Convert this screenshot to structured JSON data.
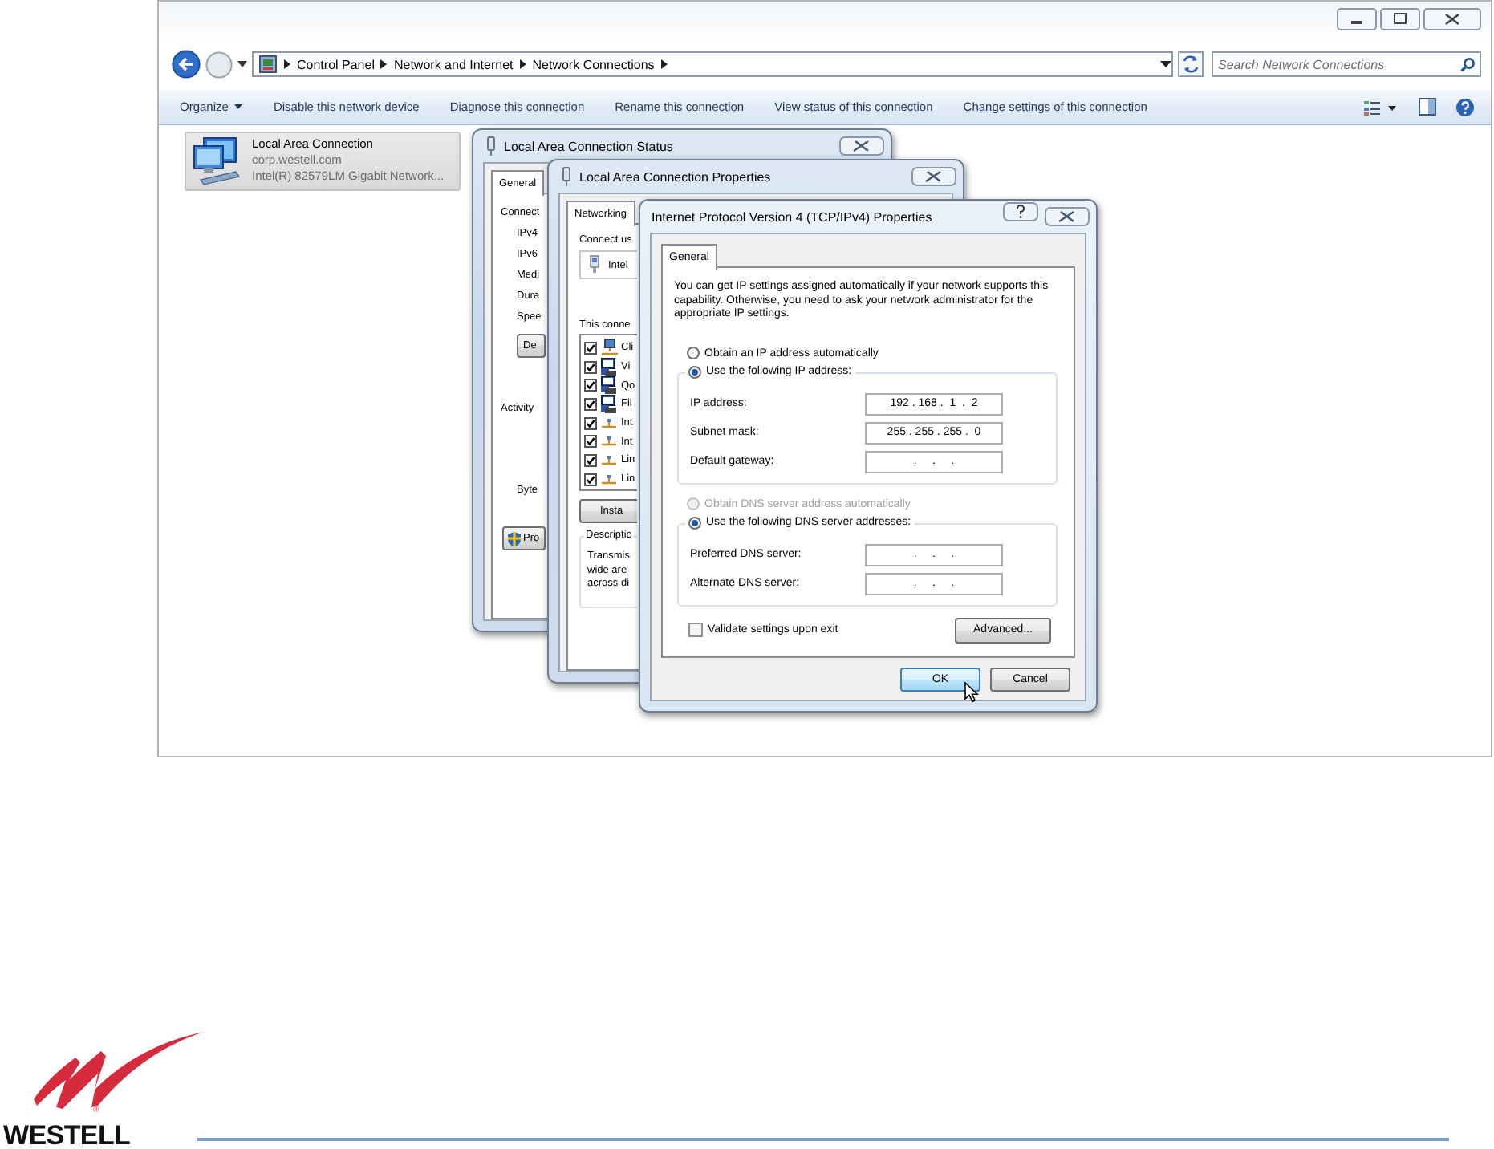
{
  "explorer": {
    "breadcrumb": [
      {
        "label": "Control Panel"
      },
      {
        "label": "Network and Internet"
      },
      {
        "label": "Network Connections"
      }
    ],
    "search": {
      "placeholder": "Search Network Connections"
    },
    "toolbar": [
      {
        "label": "Organize",
        "kind": "menu"
      },
      {
        "label": "Disable this network device",
        "kind": "command"
      },
      {
        "label": "Diagnose this connection",
        "kind": "command"
      },
      {
        "label": "Rename this connection",
        "kind": "command"
      },
      {
        "label": "View status of this connection",
        "kind": "command"
      },
      {
        "label": "Change settings of this connection",
        "kind": "command"
      }
    ],
    "connections": [
      {
        "name": "Local Area Connection",
        "domain": "corp.westell.com",
        "adapter": "Intel(R) 82579LM Gigabit Network...",
        "selected": true
      }
    ]
  },
  "status_dialog": {
    "title": "Local Area Connection Status",
    "tabs": [
      {
        "label": "General",
        "selected": true
      }
    ],
    "section": "Connect",
    "rows": [
      "IPv4",
      "IPv6",
      "Medi",
      "Dura",
      "Spee"
    ],
    "details_button": "De",
    "activity": "Activity",
    "bytes": "Byte",
    "properties_button": "Pro"
  },
  "properties_dialog": {
    "title": "Local Area Connection Properties",
    "tabs": [
      {
        "label": "Networking",
        "selected": true
      }
    ],
    "connect_using": "Connect us",
    "adapter": "Intel",
    "components_label": "This conne",
    "components": [
      {
        "label": "Cli",
        "kind": "client",
        "checked": true
      },
      {
        "label": "Vi",
        "kind": "service",
        "checked": true
      },
      {
        "label": "Qo",
        "kind": "service",
        "checked": true
      },
      {
        "label": "Fil",
        "kind": "service",
        "checked": true
      },
      {
        "label": "Int",
        "kind": "protocol",
        "checked": true
      },
      {
        "label": "Int",
        "kind": "protocol",
        "checked": true
      },
      {
        "label": "Lin",
        "kind": "protocol",
        "checked": true
      },
      {
        "label": "Lin",
        "kind": "protocol",
        "checked": true
      }
    ],
    "install_button": "Insta",
    "description": {
      "legend": "Descriptio",
      "lines": [
        "Transmis",
        "wide are",
        "across di"
      ]
    }
  },
  "ipv4_dialog": {
    "title": "Internet Protocol Version 4 (TCP/IPv4) Properties",
    "tabs": [
      {
        "label": "General",
        "selected": true
      }
    ],
    "intro": "You can get IP settings assigned automatically if your network supports this capability. Otherwise, you need to ask your network administrator for the appropriate IP settings.",
    "ip_options": [
      {
        "label": "Obtain an IP address automatically",
        "selected": false,
        "disabled": false
      },
      {
        "label": "Use the following IP address:",
        "selected": true,
        "disabled": false
      }
    ],
    "ip_fields": [
      {
        "label": "IP address:",
        "value": "192 . 168 .  1  .  2"
      },
      {
        "label": "Subnet mask:",
        "value": "255 . 255 . 255 .  0"
      },
      {
        "label": "Default gateway:",
        "value": ".     .     ."
      }
    ],
    "dns_options": [
      {
        "label": "Obtain DNS server address automatically",
        "selected": false,
        "disabled": true
      },
      {
        "label": "Use the following DNS server addresses:",
        "selected": true,
        "disabled": false
      }
    ],
    "dns_fields": [
      {
        "label": "Preferred DNS server:",
        "value": ".     .     ."
      },
      {
        "label": "Alternate DNS server:",
        "value": ".     .     ."
      }
    ],
    "validate": {
      "label": "Validate settings upon exit",
      "checked": false
    },
    "advanced_button": "Advanced...",
    "buttons": [
      {
        "label": "OK",
        "default": true
      },
      {
        "label": "Cancel",
        "default": false
      }
    ]
  },
  "footer": {
    "brand": "WESTELL",
    "registered": "®"
  }
}
